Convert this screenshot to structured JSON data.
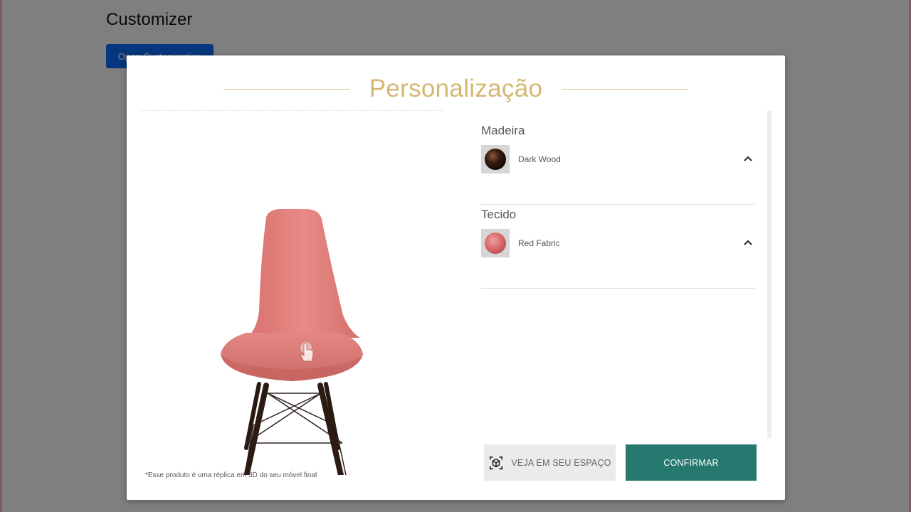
{
  "page": {
    "title": "Customizer",
    "open_button_label": "Open Customization"
  },
  "modal": {
    "title": "Personalização",
    "disclaimer": "*Esse produto é uma réplica em 3D do seu móvel final",
    "options": [
      {
        "title": "Madeira",
        "selected": "Dark Wood",
        "swatch_icon": "dark-wood-sphere"
      },
      {
        "title": "Tecido",
        "selected": "Red Fabric",
        "swatch_icon": "red-fabric-sphere"
      }
    ],
    "ar_button_label": "VEJA EM SEU ESPAÇO",
    "confirm_button_label": "CONFIRMAR"
  },
  "colors": {
    "title_gold": "#d4b872",
    "confirm_green": "#25796f",
    "seat_pink": "#e48783",
    "wood_dark": "#2e1a14",
    "primary_blue": "#0d6efd"
  }
}
